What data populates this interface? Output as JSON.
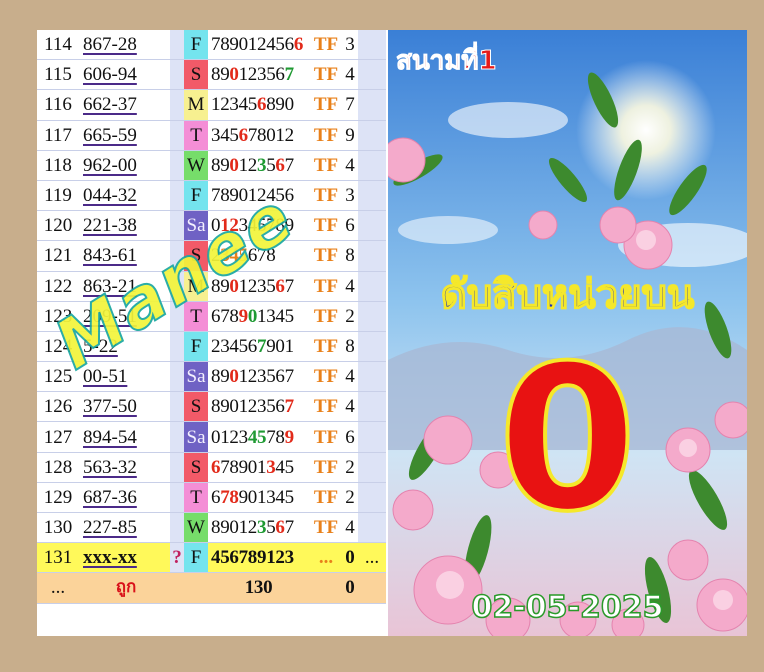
{
  "rows": [
    {
      "no": "114",
      "code": "867-28",
      "day": "F",
      "day_color": "#74e4ee",
      "digits": [
        [
          "789012456",
          ""
        ],
        [
          "6",
          "red"
        ]
      ],
      "tf": "TF",
      "res": "3"
    },
    {
      "no": "115",
      "code": "606-94",
      "day": "S",
      "day_color": "#f25a68",
      "digits": [
        [
          "89",
          ""
        ],
        [
          "0",
          "red"
        ],
        [
          "12356",
          ""
        ],
        [
          "7",
          "green"
        ]
      ],
      "tf": "TF",
      "res": "4"
    },
    {
      "no": "116",
      "code": "662-37",
      "day": "M",
      "day_color": "#f7f090",
      "digits": [
        [
          "12345",
          ""
        ],
        [
          "6",
          "red"
        ],
        [
          "890",
          ""
        ]
      ],
      "tf": "TF",
      "res": "7"
    },
    {
      "no": "117",
      "code": "665-59",
      "day": "T",
      "day_color": "#f48ed6",
      "digits": [
        [
          "345",
          ""
        ],
        [
          "6",
          "red"
        ],
        [
          "78012",
          ""
        ]
      ],
      "tf": "TF",
      "res": "9"
    },
    {
      "no": "118",
      "code": "962-00",
      "day": "W",
      "day_color": "#76dd6a",
      "digits": [
        [
          "89",
          ""
        ],
        [
          "0",
          "red"
        ],
        [
          "12",
          ""
        ],
        [
          "3",
          "green"
        ],
        [
          "5",
          ""
        ],
        [
          "6",
          "red"
        ],
        [
          "7",
          ""
        ]
      ],
      "tf": "TF",
      "res": "4"
    },
    {
      "no": "119",
      "code": "044-32",
      "day": "F",
      "day_color": "#74e4ee",
      "digits": [
        [
          "789012456",
          ""
        ]
      ],
      "tf": "TF",
      "res": "3"
    },
    {
      "no": "120",
      "code": "221-38",
      "day": "Sa",
      "day_color": "#6f62c4",
      "digits": [
        [
          "0",
          ""
        ],
        [
          "12",
          "red"
        ],
        [
          "345789",
          ""
        ]
      ],
      "tf": "TF",
      "res": "6"
    },
    {
      "no": "121",
      "code": "843-61",
      "day": "S",
      "day_color": "#f25a68",
      "digits": [
        [
          "2",
          ""
        ],
        [
          "345",
          "orange"
        ],
        [
          "67",
          ""
        ],
        [
          "8",
          ""
        ]
      ],
      "tf": "TF",
      "res": "8"
    },
    {
      "no": "122",
      "code": "863-21",
      "day": "M",
      "day_color": "#f7f090",
      "digits": [
        [
          "89",
          ""
        ],
        [
          "0",
          "red"
        ],
        [
          "12",
          ""
        ],
        [
          "3",
          ""
        ],
        [
          "5",
          ""
        ],
        [
          "6",
          "red"
        ],
        [
          "7",
          ""
        ]
      ],
      "tf": "TF",
      "res": "4"
    },
    {
      "no": "123",
      "code": "209-51",
      "day": "T",
      "day_color": "#f48ed6",
      "digits": [
        [
          "678",
          ""
        ],
        [
          "9",
          "red"
        ],
        [
          "0",
          "green"
        ],
        [
          "1345",
          ""
        ]
      ],
      "tf": "TF",
      "res": "2"
    },
    {
      "no": "124",
      "code": "5-22",
      "day": "F",
      "day_color": "#74e4ee",
      "digits": [
        [
          "23456",
          ""
        ],
        [
          "7",
          "green"
        ],
        [
          "9",
          ""
        ],
        [
          "01",
          ""
        ]
      ],
      "tf": "TF",
      "res": "8"
    },
    {
      "no": "125",
      "code": "00-51",
      "day": "Sa",
      "day_color": "#6f62c4",
      "digits": [
        [
          "89",
          ""
        ],
        [
          "0",
          "red"
        ],
        [
          "123567",
          ""
        ]
      ],
      "tf": "TF",
      "res": "4"
    },
    {
      "no": "126",
      "code": "377-50",
      "day": "S",
      "day_color": "#f25a68",
      "digits": [
        [
          "89012356",
          ""
        ],
        [
          "7",
          "red"
        ]
      ],
      "tf": "TF",
      "res": "4"
    },
    {
      "no": "127",
      "code": "894-54",
      "day": "Sa",
      "day_color": "#6f62c4",
      "digits": [
        [
          "0123",
          ""
        ],
        [
          "45",
          "green"
        ],
        [
          "78",
          ""
        ],
        [
          "9",
          "red"
        ]
      ],
      "tf": "TF",
      "res": "6"
    },
    {
      "no": "128",
      "code": "563-32",
      "day": "S",
      "day_color": "#f25a68",
      "digits": [
        [
          "6",
          "red"
        ],
        [
          "78901",
          ""
        ],
        [
          "3",
          "red"
        ],
        [
          "45",
          ""
        ]
      ],
      "tf": "TF",
      "res": "2"
    },
    {
      "no": "129",
      "code": "687-36",
      "day": "T",
      "day_color": "#f48ed6",
      "digits": [
        [
          "6",
          ""
        ],
        [
          "7",
          "red"
        ],
        [
          "8",
          "red"
        ],
        [
          "901345",
          ""
        ]
      ],
      "tf": "TF",
      "res": "2"
    },
    {
      "no": "130",
      "code": "227-85",
      "day": "W",
      "day_color": "#76dd6a",
      "digits": [
        [
          "89012",
          ""
        ],
        [
          "3",
          "green"
        ],
        [
          "5",
          ""
        ],
        [
          "6",
          "red"
        ],
        [
          "7",
          ""
        ]
      ],
      "tf": "TF",
      "res": "4"
    }
  ],
  "prediction": {
    "no": "131",
    "code": "xxx-xx",
    "q": "?",
    "day": "F",
    "day_color": "#74e4ee",
    "digits": "456789123",
    "tf": "...",
    "res": "0",
    "extra": "..."
  },
  "summary": {
    "first": "...",
    "label": "ถูก",
    "count": "130",
    "res": "0"
  },
  "watermark": "Manee",
  "art": {
    "field_label": "สนามที่1",
    "headline": "ดับสิบหน่วยบน",
    "digit": "0",
    "date": "02-05-2025"
  }
}
